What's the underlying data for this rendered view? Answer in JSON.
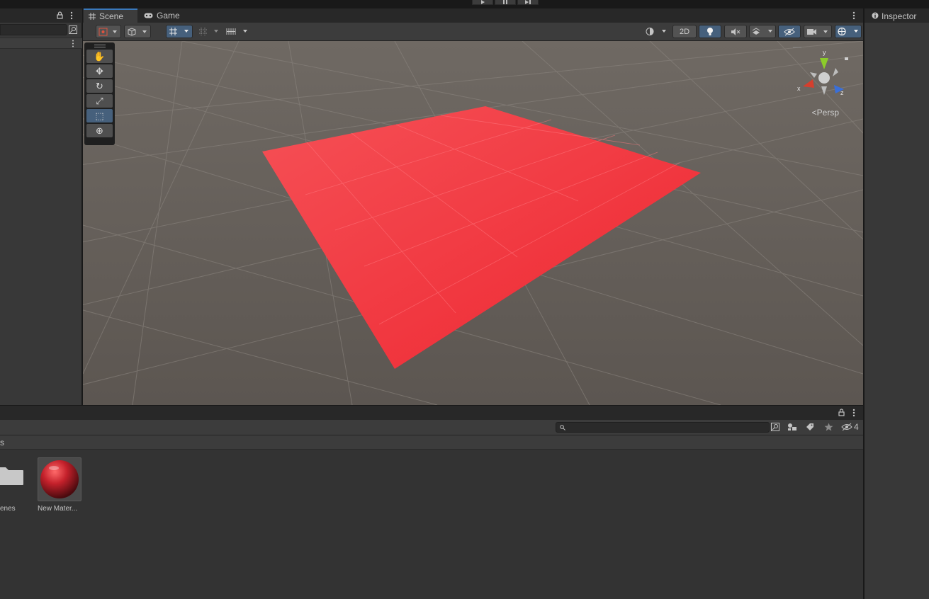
{
  "top_toolbar": {
    "play_icon": "play-icon",
    "pause_icon": "pause-icon",
    "step_icon": "step-icon"
  },
  "hierarchy": {
    "lock_icon": "lock-icon",
    "menu_icon": "kebab-menu-icon"
  },
  "scene_tabs": [
    {
      "label": "Scene",
      "icon": "grid-icon",
      "active": true
    },
    {
      "label": "Game",
      "icon": "gamepad-icon",
      "active": false
    }
  ],
  "scene_toolbar": {
    "mode_2d": "2D",
    "buttons": [
      "tool-handle-icon",
      "pivot-cube-icon",
      "grid-snap-icon",
      "grid-icon",
      "increment-snap-icon",
      "shading-sphere-icon",
      "lighting-icon",
      "audio-mute-icon",
      "effects-icon",
      "visibility-icon",
      "camera-icon",
      "gizmos-icon"
    ]
  },
  "tools": [
    "hand-icon",
    "move-icon",
    "rotate-icon",
    "scale-icon",
    "rect-icon",
    "transform-icon"
  ],
  "viewport": {
    "projection_label": "Persp",
    "gizmo_axes": {
      "x": "x",
      "y": "y",
      "z": "z"
    },
    "plane_color": "#f0303a",
    "ground_color": "#5e5954"
  },
  "project": {
    "breadcrumb": "s",
    "hidden_count": "4",
    "assets": [
      {
        "label": "enes",
        "type": "folder"
      },
      {
        "label": "New Mater...",
        "type": "material"
      }
    ]
  },
  "inspector": {
    "title": "Inspector",
    "icon": "info-icon"
  },
  "colors": {
    "accent": "#3a79bb",
    "active_button": "#46607c",
    "material": "#c4212b"
  }
}
